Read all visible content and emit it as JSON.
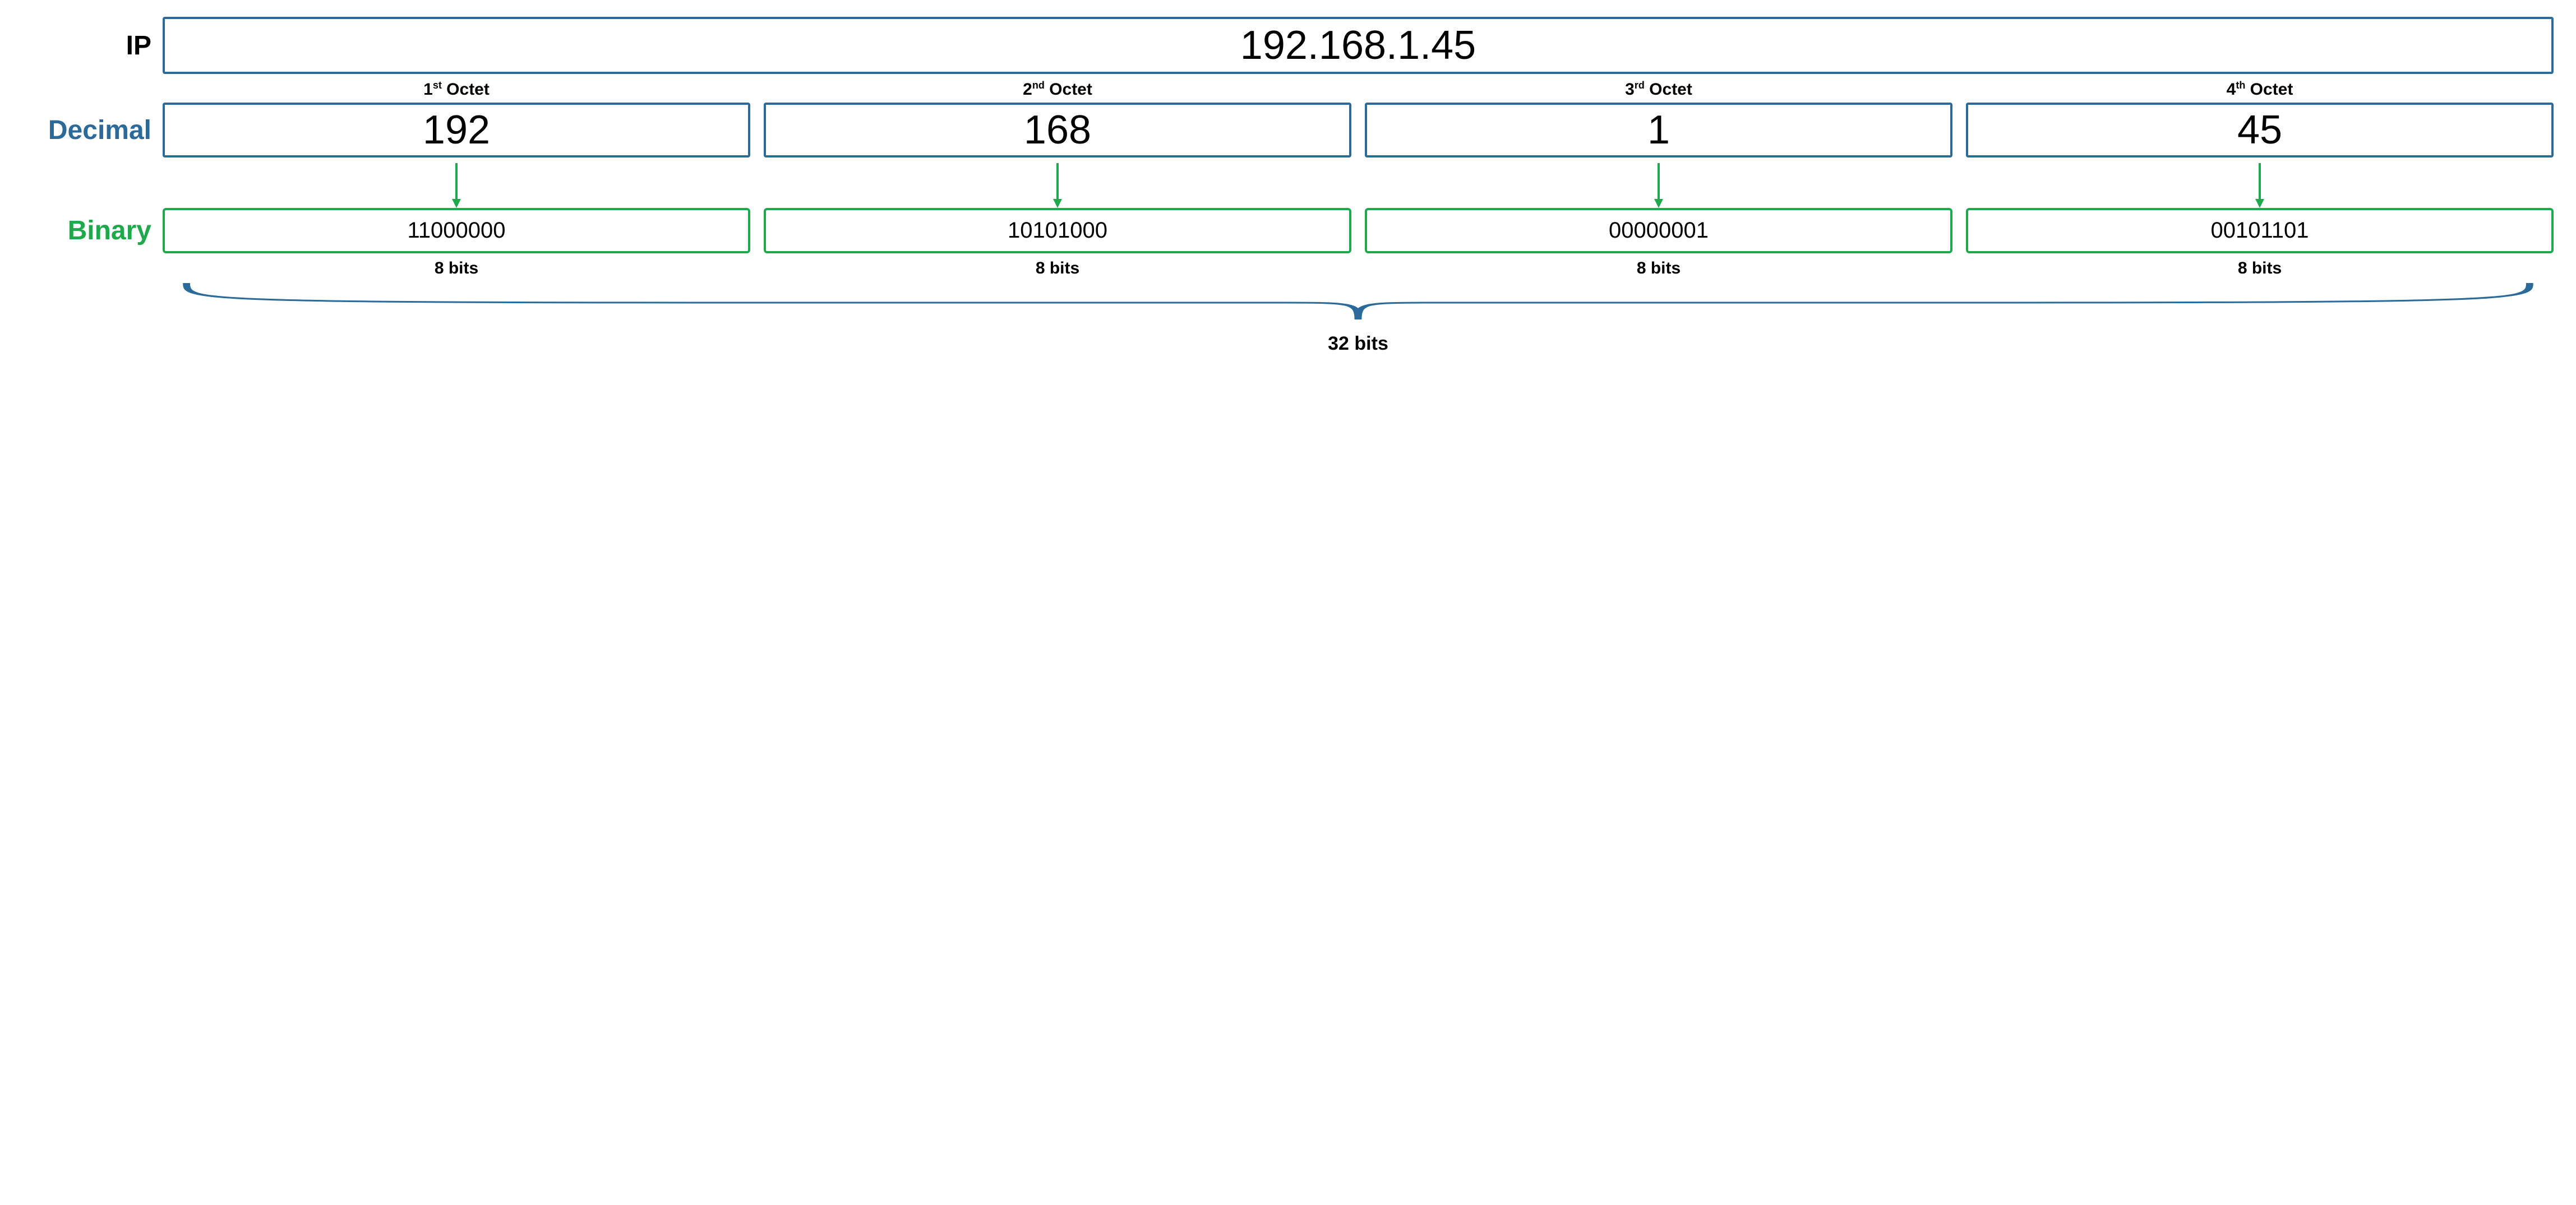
{
  "labels": {
    "ip": "IP",
    "decimal": "Decimal",
    "binary": "Binary"
  },
  "ip_address": "192.168.1.45",
  "octets": [
    {
      "ord": "1",
      "suffix": "st",
      "name": "Octet",
      "decimal": "192",
      "binary": "11000000",
      "bits": "8 bits"
    },
    {
      "ord": "2",
      "suffix": "nd",
      "name": "Octet",
      "decimal": "168",
      "binary": "10101000",
      "bits": "8 bits"
    },
    {
      "ord": "3",
      "suffix": "rd",
      "name": "Octet",
      "decimal": "1",
      "binary": "00000001",
      "bits": "8 bits"
    },
    {
      "ord": "4",
      "suffix": "th",
      "name": "Octet",
      "decimal": "45",
      "binary": "00101101",
      "bits": "8 bits"
    }
  ],
  "total_bits": "32 bits",
  "colors": {
    "blue": "#2b6a99",
    "green": "#1fa84c"
  }
}
